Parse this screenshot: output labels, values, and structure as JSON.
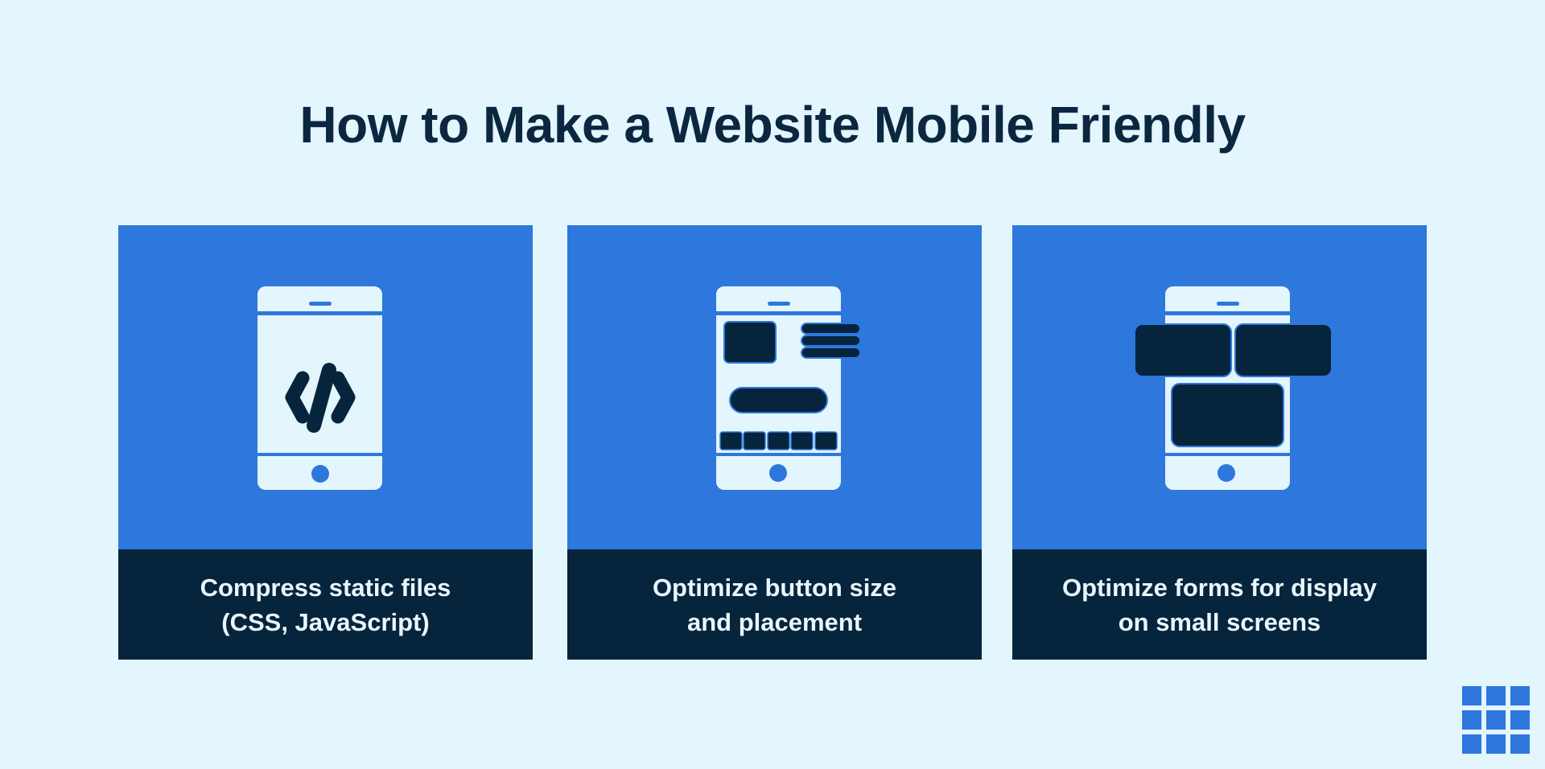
{
  "page": {
    "title": "How to Make a Website Mobile Friendly"
  },
  "colors": {
    "background": "#E3F5FD",
    "accent_blue": "#2E77DC",
    "navy": "#06243C",
    "title_text": "#0B2740",
    "phone_body": "#E3F5FD"
  },
  "cards": [
    {
      "icon": "phone-code-icon",
      "caption": "Compress static files\n(CSS, JavaScript)"
    },
    {
      "icon": "phone-buttons-layout-icon",
      "caption": "Optimize button size\nand placement"
    },
    {
      "icon": "phone-forms-icon",
      "caption": "Optimize forms for display\non small screens"
    }
  ],
  "logo": {
    "icon": "grid-logo-icon"
  }
}
